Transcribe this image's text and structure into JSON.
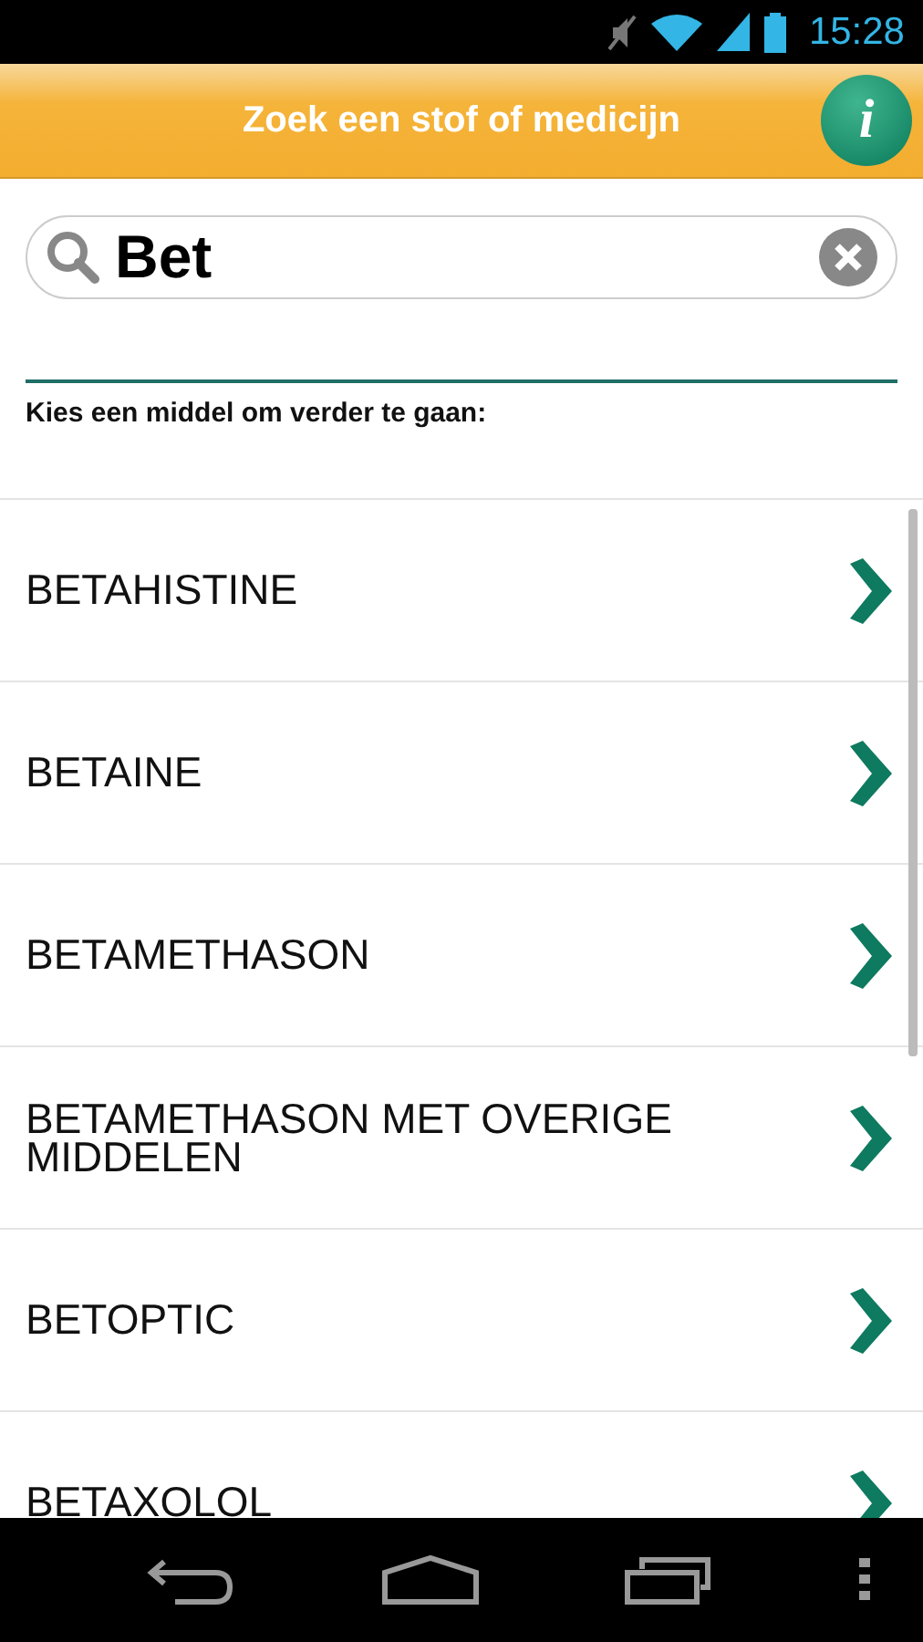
{
  "status_bar": {
    "time": "15:28"
  },
  "header": {
    "title": "Zoek een stof of medicijn",
    "info_button": "i"
  },
  "search": {
    "value": "Bet"
  },
  "instruction": "Kies een middel om verder te gaan:",
  "results": [
    {
      "name": "BETAHISTINE"
    },
    {
      "name": "BETAINE"
    },
    {
      "name": "BETAMETHASON"
    },
    {
      "name": "BETAMETHASON MET OVERIGE MIDDELEN"
    },
    {
      "name": "BETOPTIC"
    },
    {
      "name": "BETAXOLOL"
    }
  ]
}
